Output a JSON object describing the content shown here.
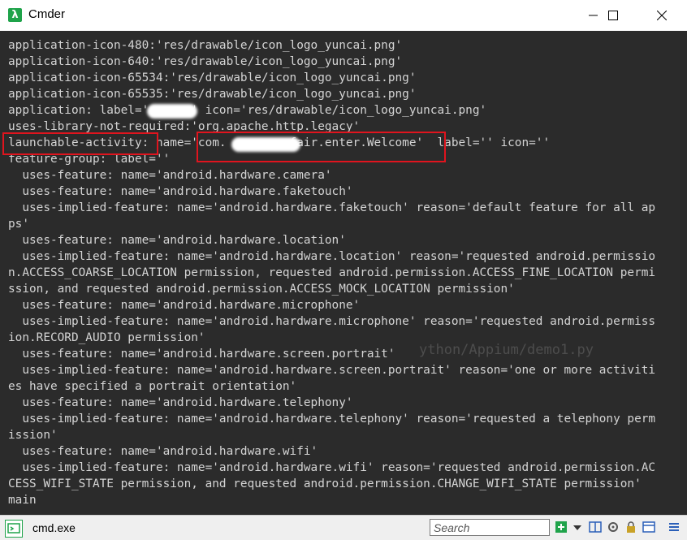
{
  "window": {
    "title": "Cmder",
    "app_icon_glyph": "λ"
  },
  "terminal": {
    "lines": [
      "application-icon-480:'res/drawable/icon_logo_yuncai.png'",
      "application-icon-640:'res/drawable/icon_logo_yuncai.png'",
      "application-icon-65534:'res/drawable/icon_logo_yuncai.png'",
      "application-icon-65535:'res/drawable/icon_logo_yuncai.png'",
      "application: label='      ' icon='res/drawable/icon_logo_yuncai.png'",
      "uses-library-not-required:'org.apache.http.legacy'",
      "launchable-activity: name='com.         fair.enter.Welcome'  label='' icon=''",
      "feature-group: label=''",
      "  uses-feature: name='android.hardware.camera'",
      "  uses-feature: name='android.hardware.faketouch'",
      "  uses-implied-feature: name='android.hardware.faketouch' reason='default feature for all ap",
      "ps'",
      "  uses-feature: name='android.hardware.location'",
      "  uses-implied-feature: name='android.hardware.location' reason='requested android.permissio",
      "n.ACCESS_COARSE_LOCATION permission, requested android.permission.ACCESS_FINE_LOCATION permi",
      "ssion, and requested android.permission.ACCESS_MOCK_LOCATION permission'",
      "  uses-feature: name='android.hardware.microphone'",
      "  uses-implied-feature: name='android.hardware.microphone' reason='requested android.permiss",
      "ion.RECORD_AUDIO permission'",
      "  uses-feature: name='android.hardware.screen.portrait'",
      "  uses-implied-feature: name='android.hardware.screen.portrait' reason='one or more activiti",
      "es have specified a portrait orientation'",
      "  uses-feature: name='android.hardware.telephony'",
      "  uses-implied-feature: name='android.hardware.telephony' reason='requested a telephony perm",
      "ission'",
      "  uses-feature: name='android.hardware.wifi'",
      "  uses-implied-feature: name='android.hardware.wifi' reason='requested android.permission.AC",
      "CESS_WIFI_STATE permission, and requested android.permission.CHANGE_WIFI_STATE permission'",
      "main"
    ],
    "ghost_text": "ython/Appium/demo1.py"
  },
  "statusbar": {
    "tab_label": "cmd.exe",
    "search_placeholder": "Search"
  },
  "colors": {
    "terminal_bg": "#2b2b2b",
    "terminal_fg": "#d4d4d4",
    "highlight": "#e0141e",
    "accent": "#1fa34a"
  },
  "icons": [
    "minimize-icon",
    "maximize-icon",
    "close-icon",
    "lambda-icon",
    "console-icon",
    "add-tab-icon",
    "split-icon",
    "settings-icon",
    "menu-icon"
  ]
}
